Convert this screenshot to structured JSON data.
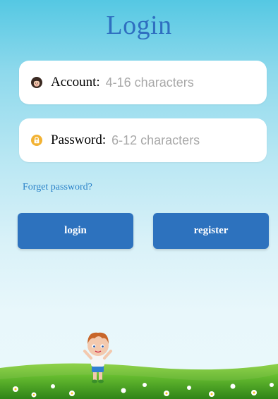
{
  "title": "Login",
  "account": {
    "label": "Account:",
    "placeholder": "4-16 characters"
  },
  "password": {
    "label": "Password:",
    "placeholder": "6-12 characters"
  },
  "forgot_label": "Forget password?",
  "buttons": {
    "login_label": "login",
    "register_label": "register"
  },
  "colors": {
    "primary": "#2d72be",
    "title": "#2f6fc0",
    "link": "#2a82c8",
    "sky_top": "#55c8e3",
    "grass": "#5cb82e"
  },
  "icons": {
    "account": "avatar-icon",
    "password": "lock-icon"
  }
}
